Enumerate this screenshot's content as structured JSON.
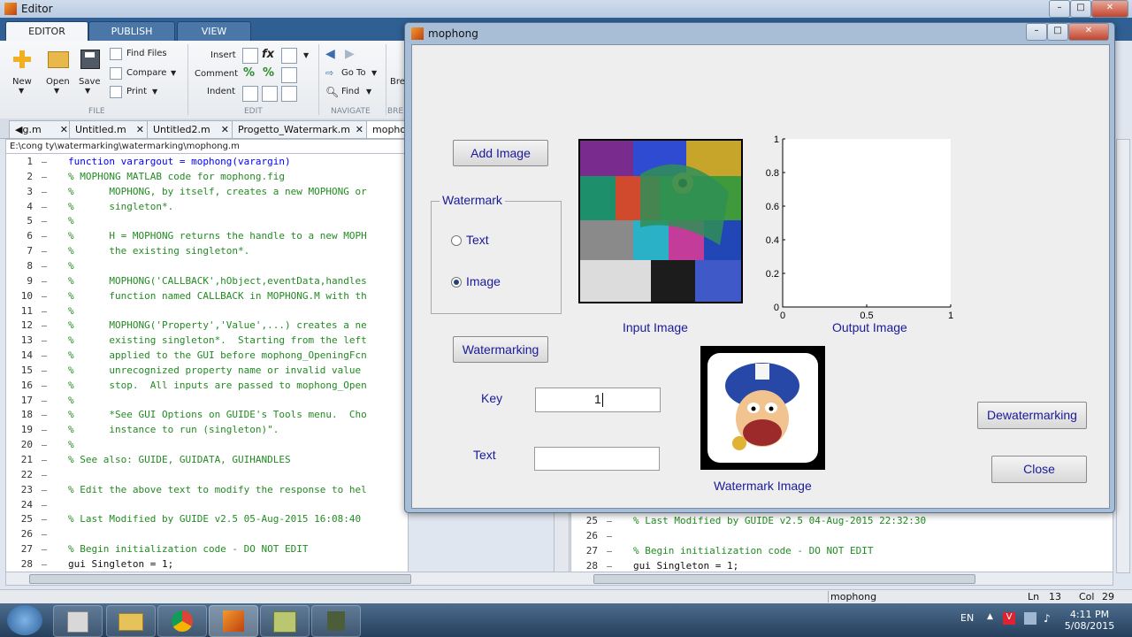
{
  "window": {
    "title": "Editor"
  },
  "ribbon_tabs": [
    "EDITOR",
    "PUBLISH",
    "VIEW"
  ],
  "toolstrip": {
    "new": "New",
    "open": "Open",
    "save": "Save",
    "find_files": "Find Files",
    "compare": "Compare",
    "print": "Print",
    "insert": "Insert",
    "comment": "Comment",
    "indent": "Indent",
    "go_to": "Go To",
    "find": "Find",
    "breakpoints": "Bre",
    "section_file": "FILE",
    "section_edit": "EDIT",
    "section_navigate": "NAVIGATE",
    "section_bre": "BRE"
  },
  "doc_tabs": [
    "g.m",
    "Untitled.m",
    "Untitled2.m",
    "Progetto_Watermark.m",
    "mophong"
  ],
  "path": "E:\\cong ty\\watermarking\\watermarking\\mophong.m",
  "code_lines": [
    {
      "n": "1",
      "t": "function varargout = mophong(varargin)",
      "c": "kw"
    },
    {
      "n": "2",
      "t": "% MOPHONG MATLAB code for mophong.fig",
      "c": "cm"
    },
    {
      "n": "3",
      "t": "%      MOPHONG, by itself, creates a new MOPHONG or",
      "c": "cm"
    },
    {
      "n": "4",
      "t": "%      singleton*.",
      "c": "cm"
    },
    {
      "n": "5",
      "t": "%",
      "c": "cm"
    },
    {
      "n": "6",
      "t": "%      H = MOPHONG returns the handle to a new MOPH",
      "c": "cm"
    },
    {
      "n": "7",
      "t": "%      the existing singleton*.",
      "c": "cm"
    },
    {
      "n": "8",
      "t": "%",
      "c": "cm"
    },
    {
      "n": "9",
      "t": "%      MOPHONG('CALLBACK',hObject,eventData,handles",
      "c": "cm"
    },
    {
      "n": "10",
      "t": "%      function named CALLBACK in MOPHONG.M with th",
      "c": "cm"
    },
    {
      "n": "11",
      "t": "%",
      "c": "cm"
    },
    {
      "n": "12",
      "t": "%      MOPHONG('Property','Value',...) creates a ne",
      "c": "cm"
    },
    {
      "n": "13",
      "t": "%      existing singleton*.  Starting from the left",
      "c": "cm"
    },
    {
      "n": "14",
      "t": "%      applied to the GUI before mophong_OpeningFcn",
      "c": "cm"
    },
    {
      "n": "15",
      "t": "%      unrecognized property name or invalid value",
      "c": "cm"
    },
    {
      "n": "16",
      "t": "%      stop.  All inputs are passed to mophong_Open",
      "c": "cm"
    },
    {
      "n": "17",
      "t": "%",
      "c": "cm"
    },
    {
      "n": "18",
      "t": "%      *See GUI Options on GUIDE's Tools menu.  Cho",
      "c": "cm"
    },
    {
      "n": "19",
      "t": "%      instance to run (singleton)\".",
      "c": "cm"
    },
    {
      "n": "20",
      "t": "%",
      "c": "cm"
    },
    {
      "n": "21",
      "t": "% See also: GUIDE, GUIDATA, GUIHANDLES",
      "c": "cm"
    },
    {
      "n": "22",
      "t": "",
      "c": ""
    },
    {
      "n": "23",
      "t": "% Edit the above text to modify the response to hel",
      "c": "cm"
    },
    {
      "n": "24",
      "t": "",
      "c": ""
    },
    {
      "n": "25",
      "t": "% Last Modified by GUIDE v2.5 05-Aug-2015 16:08:40",
      "c": "cm"
    },
    {
      "n": "26",
      "t": "",
      "c": ""
    },
    {
      "n": "27",
      "t": "% Begin initialization code - DO NOT EDIT",
      "c": "cm"
    },
    {
      "n": "28",
      "t": "gui Singleton = 1;",
      "c": ""
    }
  ],
  "code_lines_right": [
    {
      "n": "25",
      "t": "% Last Modified by GUIDE v2.5 04-Aug-2015 22:32:30",
      "c": "cm"
    },
    {
      "n": "26",
      "t": "",
      "c": ""
    },
    {
      "n": "27",
      "t": "% Begin initialization code - DO NOT EDIT",
      "c": "cm"
    },
    {
      "n": "28",
      "t": "gui Singleton = 1;",
      "c": ""
    }
  ],
  "status": {
    "name": "mophong",
    "ln_label": "Ln",
    "ln": "13",
    "col_label": "Col",
    "col": "29"
  },
  "taskbar": {
    "lang": "EN",
    "time": "4:11 PM",
    "date": "5/08/2015"
  },
  "mophong": {
    "title": "mophong",
    "add_image": "Add Image",
    "watermark_group": "Watermark",
    "radio_text": "Text",
    "radio_image": "Image",
    "selected": "Image",
    "watermarking": "Watermarking",
    "key_label": "Key",
    "key_value": "1",
    "text_label": "Text",
    "text_value": "",
    "input_image_label": "Input Image",
    "output_image_label": "Output  Image",
    "watermark_image_label": "Watermark Image",
    "dewatermarking": "Dewatermarking",
    "close": "Close"
  },
  "chart_data": {
    "type": "scatter",
    "title": "",
    "xlabel": "",
    "ylabel": "",
    "xlim": [
      0,
      1
    ],
    "ylim": [
      0,
      1
    ],
    "x_ticks": [
      "0",
      "0.5",
      "1"
    ],
    "y_ticks": [
      "0",
      "0.2",
      "0.4",
      "0.6",
      "0.8",
      "1"
    ],
    "series": []
  }
}
